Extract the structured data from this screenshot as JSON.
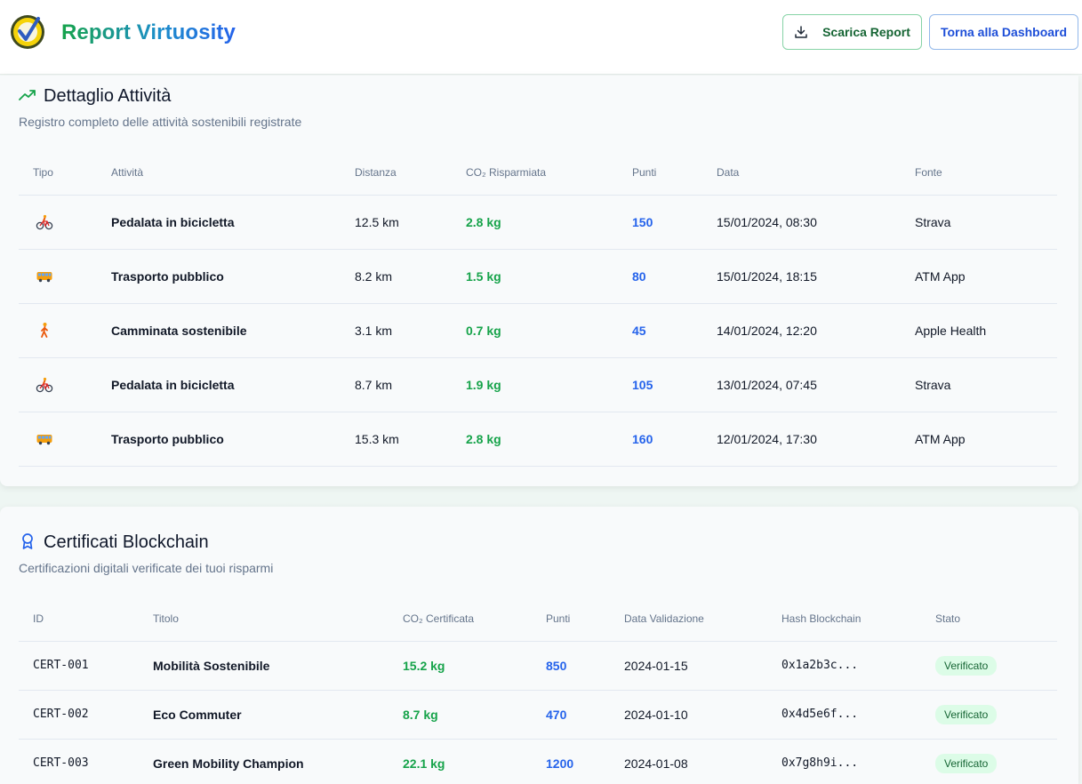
{
  "header": {
    "title": "Report Virtuosity",
    "download_label": "Scarica Report",
    "back_label": "Torna alla Dashboard"
  },
  "colors": {
    "green": "#16a34a",
    "blue": "#2563eb",
    "brand_gradient": [
      "#16a34a",
      "#2563eb"
    ]
  },
  "activities": {
    "title": "Dettaglio Attività",
    "subtitle": "Registro completo delle attività sostenibili registrate",
    "columns": [
      "Tipo",
      "Attività",
      "Distanza",
      "CO₂ Risparmiata",
      "Punti",
      "Data",
      "Fonte"
    ],
    "rows": [
      {
        "icon": "bicycle-icon",
        "activity": "Pedalata in bicicletta",
        "distance": "12.5 km",
        "co2": "2.8 kg",
        "points": "150",
        "date": "15/01/2024, 08:30",
        "source": "Strava"
      },
      {
        "icon": "bus-icon",
        "activity": "Trasporto pubblico",
        "distance": "8.2 km",
        "co2": "1.5 kg",
        "points": "80",
        "date": "15/01/2024, 18:15",
        "source": "ATM App"
      },
      {
        "icon": "walking-icon",
        "activity": "Camminata sostenibile",
        "distance": "3.1 km",
        "co2": "0.7 kg",
        "points": "45",
        "date": "14/01/2024, 12:20",
        "source": "Apple Health"
      },
      {
        "icon": "bicycle-icon",
        "activity": "Pedalata in bicicletta",
        "distance": "8.7 km",
        "co2": "1.9 kg",
        "points": "105",
        "date": "13/01/2024, 07:45",
        "source": "Strava"
      },
      {
        "icon": "bus-icon",
        "activity": "Trasporto pubblico",
        "distance": "15.3 km",
        "co2": "2.8 kg",
        "points": "160",
        "date": "12/01/2024, 17:30",
        "source": "ATM App"
      }
    ]
  },
  "certificates": {
    "title": "Certificati Blockchain",
    "subtitle": "Certificazioni digitali verificate dei tuoi risparmi",
    "columns": [
      "ID",
      "Titolo",
      "CO₂ Certificata",
      "Punti",
      "Data Validazione",
      "Hash Blockchain",
      "Stato"
    ],
    "rows": [
      {
        "id": "CERT-001",
        "title": "Mobilità Sostenibile",
        "co2": "15.2 kg",
        "points": "850",
        "date": "2024-01-15",
        "hash": "0x1a2b3c...",
        "status": "Verificato"
      },
      {
        "id": "CERT-002",
        "title": "Eco Commuter",
        "co2": "8.7 kg",
        "points": "470",
        "date": "2024-01-10",
        "hash": "0x4d5e6f...",
        "status": "Verificato"
      },
      {
        "id": "CERT-003",
        "title": "Green Mobility Champion",
        "co2": "22.1 kg",
        "points": "1200",
        "date": "2024-01-08",
        "hash": "0x7g8h9i...",
        "status": "Verificato"
      }
    ]
  }
}
